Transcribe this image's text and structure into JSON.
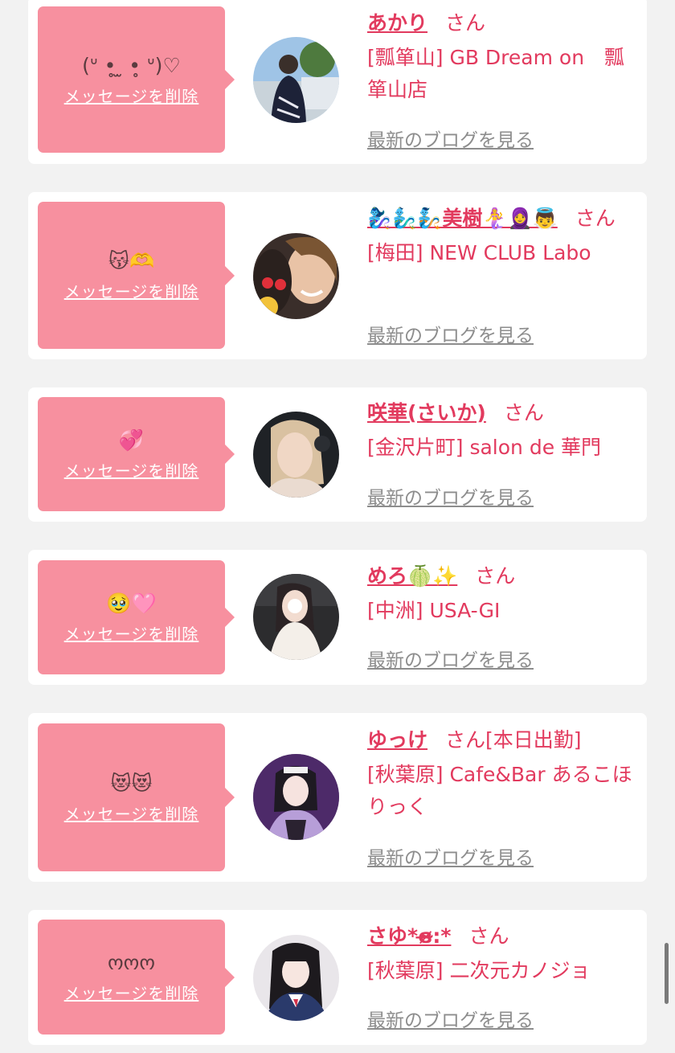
{
  "common": {
    "delete_label": "メッセージを削除",
    "blog_label": "最新のブログを見る",
    "honorific": "さん"
  },
  "cards": [
    {
      "message": "(ᐡ •̥ ̫ •̥ ᐡ)♡",
      "name": "あかり",
      "tag": "",
      "shop": "[瓢箪山] GB Dream on　瓢箪山店",
      "avatar": "avatar-photo"
    },
    {
      "message": "😽🫶",
      "name": "🧞‍♀️🧞‍♂️🧞美樹🧜‍♀️🧕👼",
      "tag": "",
      "shop": "[梅田] NEW CLUB Labo",
      "avatar": "avatar-photo"
    },
    {
      "message": "💞",
      "name": "咲華(さいか)",
      "tag": "",
      "shop": "[金沢片町] salon de 華門",
      "avatar": "avatar-photo"
    },
    {
      "message": "🥹🩷",
      "name": "めろ🍈✨",
      "tag": "",
      "shop": "[中洲] USA-GI",
      "avatar": "avatar-photo"
    },
    {
      "message": "😻😻",
      "name": "ゆっけ",
      "tag": "[本日出勤]",
      "shop": "[秋葉原] Cafe&Bar あるこほりっく",
      "avatar": "avatar-photo"
    },
    {
      "message": "ოოო",
      "name": "さゆ*ɞ̴̶̷:*",
      "tag": "",
      "shop": "[秋葉原] 二次元カノジョ",
      "avatar": "avatar-photo"
    }
  ],
  "colors": {
    "accent": "#e23a5e",
    "bubble": "#f7909f",
    "card": "#ffffff",
    "background": "#f2f2f2",
    "blog_link": "#8d8d8d"
  }
}
